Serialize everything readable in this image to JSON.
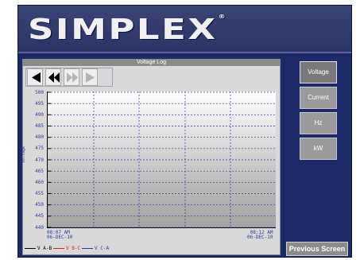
{
  "header": {
    "logo_text": "SIMPLEX",
    "logo_mark": "®"
  },
  "panel": {
    "title": "Voltage Log",
    "nav_buttons": [
      {
        "icon": "triangle-left-icon"
      },
      {
        "icon": "double-triangle-left-icon"
      },
      {
        "icon": "double-triangle-right-icon"
      },
      {
        "icon": "triangle-right-icon"
      }
    ]
  },
  "chart_data": {
    "type": "line",
    "title": "Voltage Log",
    "ylabel": "Voltage",
    "ylim": [
      440,
      500
    ],
    "yticks": [
      500,
      495,
      490,
      485,
      480,
      475,
      470,
      465,
      460,
      455,
      450,
      445,
      440
    ],
    "x_start": {
      "time": "08:07 AM",
      "date": "06-DEC-10"
    },
    "x_end": {
      "time": "08:12 AM",
      "date": "06-DEC-10"
    },
    "grid": true,
    "legend_placement": "bottom",
    "series": [
      {
        "name": "V A-B",
        "color": "#000000"
      },
      {
        "name": "V B-C",
        "color": "#e02020"
      },
      {
        "name": "V C-A",
        "color": "#2a3aa0"
      }
    ]
  },
  "sidebar": {
    "buttons": [
      {
        "label": "Voltage",
        "active": true
      },
      {
        "label": "Current",
        "active": false
      },
      {
        "label": "Hz",
        "active": false
      },
      {
        "label": "kW",
        "active": false
      }
    ]
  },
  "footer": {
    "previous_screen_label": "Previous Screen"
  }
}
